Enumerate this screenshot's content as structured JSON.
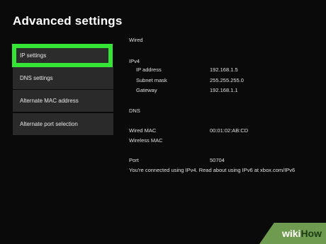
{
  "page": {
    "title": "Advanced settings"
  },
  "menu": {
    "items": [
      {
        "label": "IP settings"
      },
      {
        "label": "DNS settings"
      },
      {
        "label": "Alternate MAC address"
      },
      {
        "label": "Alternate port selection"
      }
    ]
  },
  "details": {
    "wired_heading": "Wired",
    "ipv4_heading": "IPv4",
    "ip_address_label": "IP address",
    "ip_address_value": "192.168.1.5",
    "subnet_mask_label": "Subnet mask",
    "subnet_mask_value": "255.255.255.0",
    "gateway_label": "Gateway",
    "gateway_value": "192.168.1.1",
    "dns_heading": "DNS",
    "wired_mac_label": "Wired MAC",
    "wired_mac_value": "00:01:02:AB:CD",
    "wireless_mac_label": "Wireless MAC",
    "port_label": "Port",
    "port_value": "50704",
    "connection_note": "You're connected using IPv4. Read about using IPv6 at xbox.com/IPv6"
  },
  "watermark": {
    "part1": "wiki",
    "part2": "How"
  },
  "colors": {
    "selection_highlight": "#35e535",
    "background": "#0a0a0a"
  }
}
